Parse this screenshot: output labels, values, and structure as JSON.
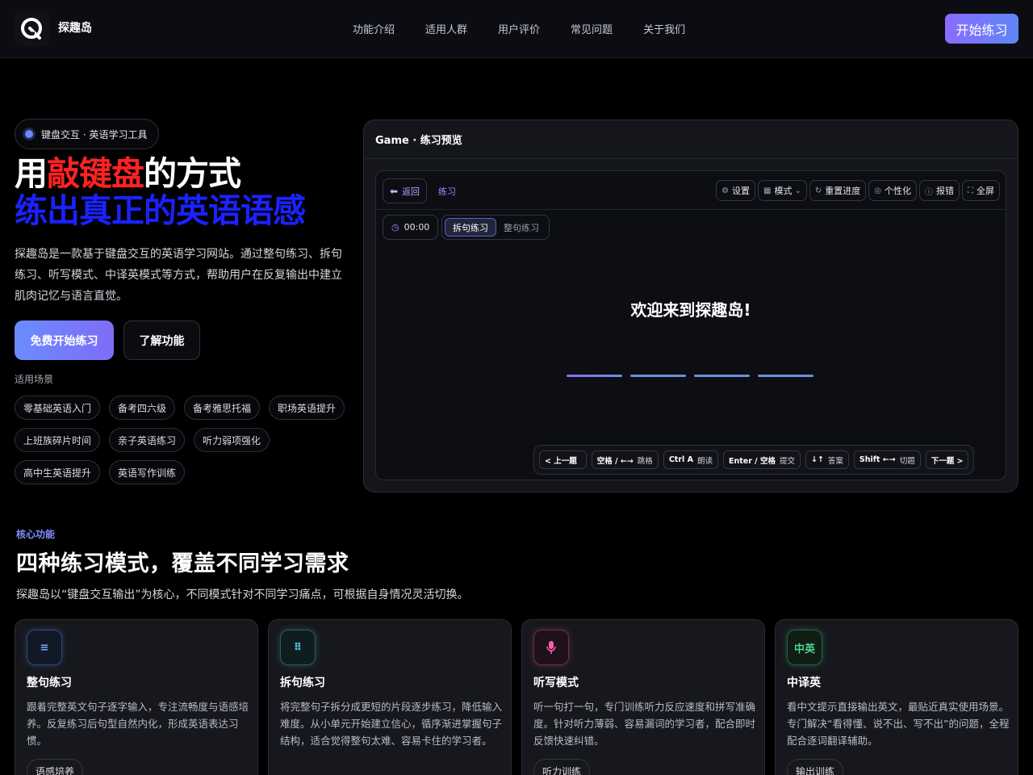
{
  "header": {
    "brand": "探趣岛",
    "nav": [
      "功能介绍",
      "适用人群",
      "用户评价",
      "常见问题",
      "关于我们"
    ],
    "cta": "开始练习"
  },
  "hero": {
    "badge": "键盘交互 · 英语学习工具",
    "title_part1": "用",
    "title_highlight": "敲键盘",
    "title_part2": "的方式",
    "title_line2": "练出真正的英语语感",
    "description": "探趣岛是一款基于键盘交互的英语学习网站。通过整句练习、拆句练习、听写模式、中译英模式等方式，帮助用户在反复输出中建立肌肉记忆与语言直觉。",
    "primary_button": "免费开始练习",
    "secondary_button": "了解功能",
    "scene_label": "适用场景",
    "tags": [
      [
        "零基础英语入门",
        "备考四六级",
        "备考雅思托福",
        "职场英语提升"
      ],
      [
        "上班族碎片时间",
        "亲子英语练习",
        "听力弱项强化"
      ],
      [
        "高中生英语提升",
        "英语写作训练"
      ]
    ]
  },
  "preview": {
    "header": "Game · 练习预览",
    "back": "返回",
    "crumb": "练习",
    "tools": [
      "设置",
      "模式",
      "重置进度",
      "个性化",
      "报错",
      "全屏"
    ],
    "timer": "00:00",
    "segments": [
      "拆句练习",
      "整句练习"
    ],
    "welcome": "欢迎来到探趣岛!",
    "shortcuts": [
      {
        "key": "< 上一题",
        "label": ""
      },
      {
        "key": "空格 / ←→",
        "label": "跳格"
      },
      {
        "key": "Ctrl A",
        "label": "朗读"
      },
      {
        "key": "Enter / 空格",
        "label": "提交"
      },
      {
        "key": "↓↑",
        "label": "答案"
      },
      {
        "key": "Shift ←→",
        "label": "切题"
      },
      {
        "key": "下一题 >",
        "label": ""
      }
    ]
  },
  "features": {
    "label": "核心功能",
    "title": "四种练习模式，覆盖不同学习需求",
    "description": "探趣岛以“键盘交互输出”为核心，不同模式针对不同学习痛点，可根据自身情况灵活切换。",
    "cards": [
      {
        "icon": "list-icon",
        "icon_text": "≡",
        "title": "整句练习",
        "desc": "跟着完整英文句子逐字输入，专注流畅度与语感培养。反复练习后句型自然内化，形成英语表达习惯。",
        "tag": "语感培养"
      },
      {
        "icon": "grid-icon",
        "icon_text": "⠿",
        "title": "拆句练习",
        "desc": "将完整句子拆分成更短的片段逐步练习，降低输入难度。从小单元开始建立信心，循序渐进掌握句子结构，适合觉得整句太难、容易卡住的学习者。",
        "tag": ""
      },
      {
        "icon": "microphone-icon",
        "icon_text": "🎙",
        "title": "听写模式",
        "desc": "听一句打一句，专门训练听力反应速度和拼写准确度。针对听力薄弱、容易漏词的学习者，配合即时反馈快速纠错。",
        "tag": "听力训练"
      },
      {
        "icon": "translate-icon",
        "icon_text": "中英",
        "title": "中译英",
        "desc": "看中文提示直接输出英文，最贴近真实使用场景。专门解决“看得懂、说不出、写不出”的问题，全程配合逐词翻译辅助。",
        "tag": "输出训练"
      }
    ]
  }
}
